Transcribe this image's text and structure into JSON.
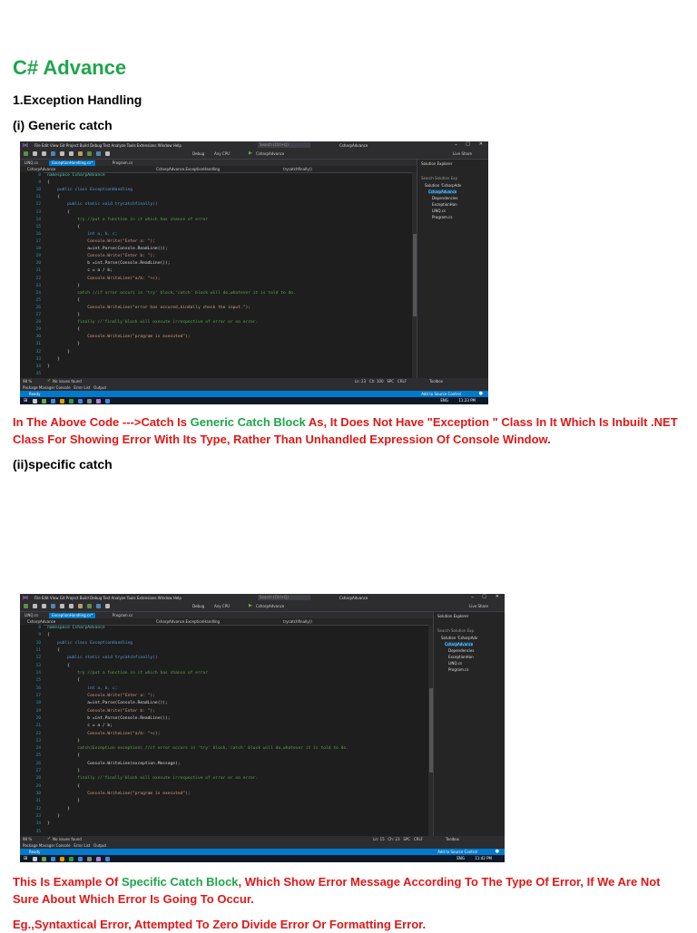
{
  "doc": {
    "title": "C# Advance",
    "section": "1.Exception Handling",
    "sub1": "(i) Generic catch",
    "note1": {
      "a": "In The Above Code --->Catch Is ",
      "b": "Generic Catch Block",
      "c": " As, It Does Not Have  \"Exception \" Class In It Which Is Inbuilt .NET Class For Showing Error With Its Type, Rather Than Unhandled Expression Of Console Window."
    },
    "sub2": "(ii)specific catch",
    "note2": {
      "a": "This Is Example Of ",
      "b": "Specific Catch Block",
      "c": ", Which Show Error Message According To The Type Of Error, If We Are Not Sure About Which Error Is Going To Occur."
    },
    "note3": "Eg.,Syntaxtical Error, Attempted To Zero Divide Error Or Formatting Error."
  },
  "vs": {
    "menu": "File  Edit  View  Git  Project  Build  Debug  Test  Analyze  Tools  Extensions  Window  Help",
    "search": "Search (Ctrl+Q)",
    "solution_name": "CsharpAdvance",
    "tabs": [
      "LINQ.cs",
      "ExceptionHandling.cs*",
      "Program.cs"
    ],
    "nav_project": "CsharpAdvance",
    "nav_class": "CsharpAdvance.ExceptionHandling",
    "nav_method": "trycatchfinally()",
    "toolbar_debug": "Debug",
    "toolbar_cpu": "Any CPU",
    "toolbar_run": "CsharpAdvance",
    "live_share": "Live Share",
    "solution_explorer": "Solution Explorer",
    "search_solution": "Search Solution Exp",
    "sol_items": [
      "Solution 'CsharpAdv",
      "CsharpAdvance",
      "Dependencies",
      "ExceptionHan",
      "LINQ.cs",
      "Program.cs"
    ],
    "zoom": "98 %",
    "issues": "No issues found",
    "bottom_tabs": "Package Manager Console   Error List   Output",
    "status": "Ready",
    "source_control": "Add to Source Control",
    "toolbox": "Toolbox",
    "line_numbers": [
      "8",
      "9",
      "10",
      "11",
      "12",
      "13",
      "14",
      "15",
      "16",
      "17",
      "18",
      "19",
      "20",
      "21",
      "22",
      "23",
      "24",
      "25",
      "26",
      "27",
      "28",
      "29",
      "30",
      "31",
      "32",
      "33",
      "34",
      "35"
    ]
  },
  "shot1": {
    "cursor": "Ln: 23   Ch: 100   SPC   CRLF",
    "clock": "11:23 PM",
    "lang": "ENG",
    "lines": [
      {
        "t": "namespace CsharpAdvance",
        "c": "ty"
      },
      {
        "t": "{",
        "c": ""
      },
      {
        "t": "    public class ExceptionHandling",
        "c": "kw"
      },
      {
        "t": "    {",
        "c": ""
      },
      {
        "t": "        public static void trycatchfinally()",
        "c": "kw"
      },
      {
        "t": "        {",
        "c": ""
      },
      {
        "t": "            try //put a function in it which has chance of error",
        "c": "cm"
      },
      {
        "t": "            {",
        "c": ""
      },
      {
        "t": "                int a, b, c;",
        "c": "kw"
      },
      {
        "t": "                Console.Write(\"Enter a: \");",
        "c": "str"
      },
      {
        "t": "                a=int.Parse(Console.ReadLine());",
        "c": ""
      },
      {
        "t": "                Console.Write(\"Enter b: \");",
        "c": "str"
      },
      {
        "t": "                b =int.Parse(Console.ReadLine());",
        "c": ""
      },
      {
        "t": "                c = a / b;",
        "c": ""
      },
      {
        "t": "                Console.WriteLine(\"a/b: \"+c);",
        "c": "str"
      },
      {
        "t": "            }",
        "c": ""
      },
      {
        "t": "            catch //if error occurs in 'try' block,'catch' block will do,whatever it is told to do.",
        "c": "cm"
      },
      {
        "t": "            {",
        "c": ""
      },
      {
        "t": "                Console.WriteLine(\"error has occured,kindally check the input.\");",
        "c": "str"
      },
      {
        "t": "            }",
        "c": ""
      },
      {
        "t": "            finally //'finally'block will execute irrespective of error or no error.",
        "c": "cm"
      },
      {
        "t": "            {",
        "c": ""
      },
      {
        "t": "                Console.WriteLine(\"program is executed\");",
        "c": "str"
      },
      {
        "t": "            }",
        "c": ""
      },
      {
        "t": "        }",
        "c": ""
      },
      {
        "t": "    }",
        "c": ""
      },
      {
        "t": "}",
        "c": ""
      },
      {
        "t": "",
        "c": ""
      }
    ]
  },
  "shot2": {
    "cursor": "Ln: 15   Ch: 23   SPC   CRLF",
    "clock": "11:42 PM",
    "lang": "ENG",
    "lines": [
      {
        "t": "namespace CsharpAdvance",
        "c": "ty"
      },
      {
        "t": "{",
        "c": ""
      },
      {
        "t": "    public class ExceptionHandling",
        "c": "kw"
      },
      {
        "t": "    {",
        "c": ""
      },
      {
        "t": "        public static void trycatchfinally()",
        "c": "kw"
      },
      {
        "t": "        {",
        "c": ""
      },
      {
        "t": "            try //put a function in it which has chance of error",
        "c": "cm"
      },
      {
        "t": "            {",
        "c": ""
      },
      {
        "t": "                int a, b, c;",
        "c": "kw"
      },
      {
        "t": "                Console.Write(\"Enter a: \");",
        "c": "str"
      },
      {
        "t": "                a=int.Parse(Console.ReadLine());",
        "c": ""
      },
      {
        "t": "                Console.Write(\"Enter b: \");",
        "c": "str"
      },
      {
        "t": "                b =int.Parse(Console.ReadLine());",
        "c": ""
      },
      {
        "t": "                c = a / b;",
        "c": ""
      },
      {
        "t": "                Console.WriteLine(\"a/b: \"+c);",
        "c": "str"
      },
      {
        "t": "            }",
        "c": ""
      },
      {
        "t": "            catch(Exception exception) //if error occurs in 'try' block,'catch' block will do,whatever it is told to do.",
        "c": "cm"
      },
      {
        "t": "            {",
        "c": ""
      },
      {
        "t": "                Console.WriteLine(exception.Message);",
        "c": ""
      },
      {
        "t": "            }",
        "c": ""
      },
      {
        "t": "            finally //'finally'block will execute irrespective of error or no error.",
        "c": "cm"
      },
      {
        "t": "            {",
        "c": ""
      },
      {
        "t": "                Console.WriteLine(\"program is executed\");",
        "c": "str"
      },
      {
        "t": "            }",
        "c": ""
      },
      {
        "t": "        }",
        "c": ""
      },
      {
        "t": "    }",
        "c": ""
      },
      {
        "t": "}",
        "c": ""
      },
      {
        "t": "",
        "c": ""
      }
    ]
  }
}
